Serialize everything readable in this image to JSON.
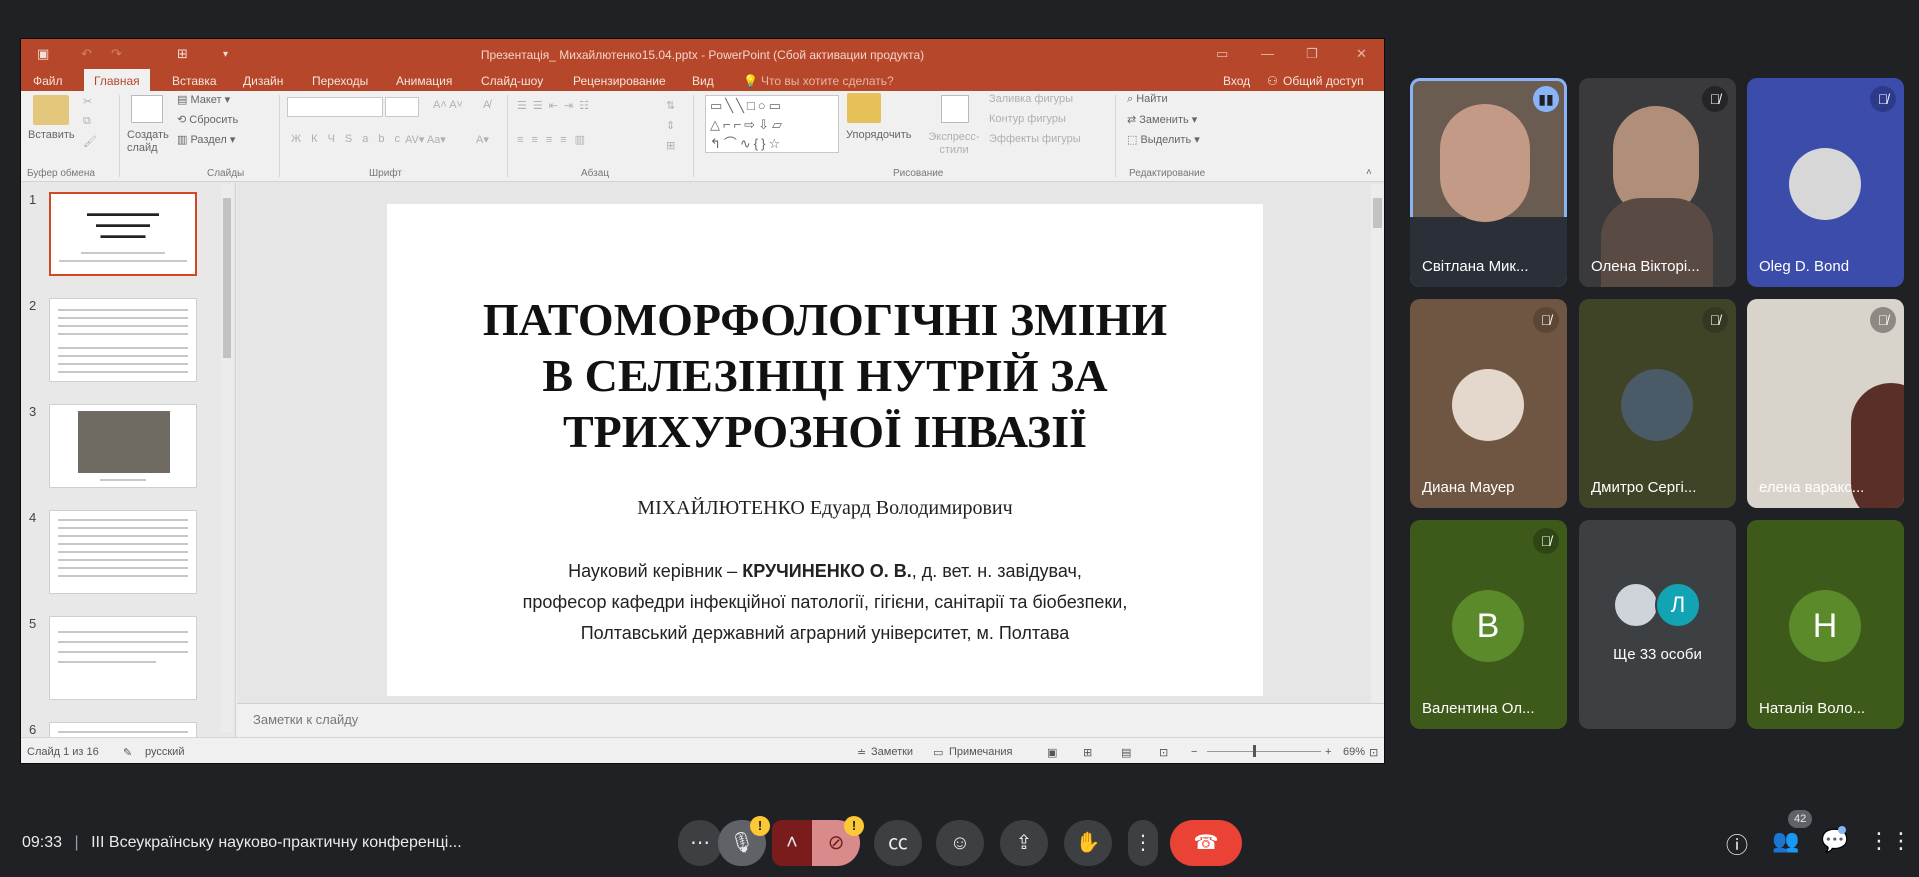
{
  "ppt": {
    "window_title": "Презентація_ Михайлютенко15.04.pptx - PowerPoint (Сбой активации продукта)",
    "tabs": [
      "Файл",
      "Главная",
      "Вставка",
      "Дизайн",
      "Переходы",
      "Анимация",
      "Слайд-шоу",
      "Рецензирование",
      "Вид"
    ],
    "tell_me": "Что вы хотите сделать?",
    "signin": "Вход",
    "share": "Общий доступ",
    "ribbon": {
      "paste": "Вставить",
      "new_slide": "Создать слайд",
      "layout": "Макет",
      "reset": "Сбросить",
      "section": "Раздел",
      "arrange": "Упорядочить",
      "express_styles": "Экспресс-стили",
      "fill": "Заливка фигуры",
      "outline": "Контур фигуры",
      "effects": "Эффекты фигуры",
      "find": "Найти",
      "replace": "Заменить",
      "select": "Выделить",
      "groups": [
        "Буфер обмена",
        "Слайды",
        "Шрифт",
        "Абзац",
        "Рисование",
        "Редактирование"
      ]
    },
    "thumbnails": [
      "1",
      "2",
      "3",
      "4",
      "5",
      "6"
    ],
    "slide": {
      "title_lines": [
        "ПАТОМОРФОЛОГІЧНІ ЗМІНИ",
        "В СЕЛЕЗІНЦІ НУТРІЙ ЗА",
        "ТРИХУРОЗНОЇ ІНВАЗІЇ"
      ],
      "author": "МІХАЙЛЮТЕНКО Едуард Володимирович",
      "sup_prefix": "Науковий керівник – ",
      "sup_name": "КРУЧИНЕНКО О. В.",
      "sup_rest": ", д. вет. н. завідувач,",
      "line2": "професор кафедри інфекційної патології, гігієни, санітарії та біобезпеки,",
      "line3": "Полтавський державний аграрний університет, м. Полтава"
    },
    "notes_placeholder": "Заметки к слайду",
    "status": {
      "slide_info": "Слайд 1 из 16",
      "lang": "русский",
      "notes": "Заметки",
      "comments": "Примечания",
      "zoom": "69%"
    }
  },
  "participants": [
    {
      "name": "Світлана Мик...",
      "type": "video",
      "mic": "speaking"
    },
    {
      "name": "Олена Вікторі...",
      "type": "video",
      "mic": "muted"
    },
    {
      "name": "Oleg D. Bond",
      "type": "photo",
      "mic": "muted"
    },
    {
      "name": "Диана Мауер",
      "type": "photo",
      "mic": "muted"
    },
    {
      "name": "Дмитро Сергі...",
      "type": "photo",
      "mic": "muted"
    },
    {
      "name": "елена варакс...",
      "type": "video",
      "mic": "muted"
    },
    {
      "name": "Валентина Ол...",
      "type": "initial",
      "initial": "В",
      "mic": "muted"
    },
    {
      "name": "Ще 33 особи",
      "type": "more",
      "initial": "Л"
    },
    {
      "name": "Наталія Воло...",
      "type": "initial",
      "initial": "Н"
    }
  ],
  "colors": {
    "accent_blue": "#8ab4f8",
    "green_tile": "#3d5a1a",
    "avatar_green": "#5a8a2a",
    "end_call": "#ea4335",
    "ppt_red": "#b7472a"
  },
  "meeting": {
    "time": "09:33",
    "separator": "|",
    "title": "ІІІ Всеукраїнську науково-практичну конференці...",
    "participants_count": "42",
    "warn": "!"
  },
  "icons": [
    "more-icon",
    "mic-icon",
    "chevron-up-icon",
    "camera-off-icon",
    "captions-icon",
    "emoji-icon",
    "present-icon",
    "hand-icon",
    "more-vert-icon",
    "end-call-icon",
    "info-icon",
    "people-icon",
    "chat-icon",
    "apps-icon"
  ]
}
